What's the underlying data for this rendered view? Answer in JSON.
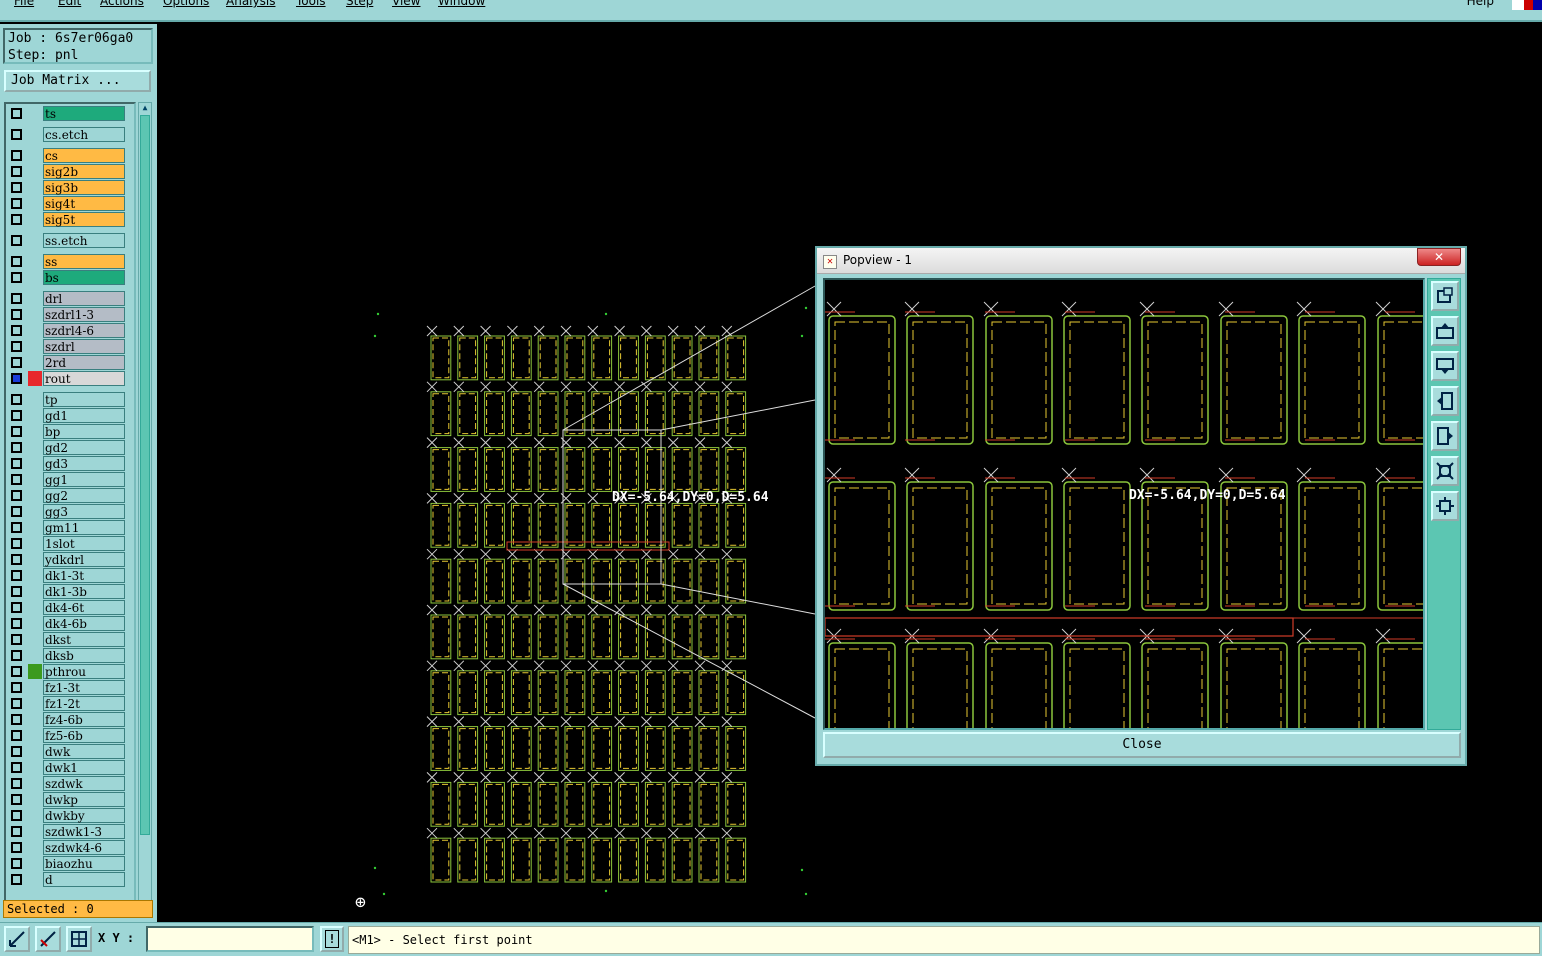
{
  "menubar": {
    "items": [
      "File",
      "Edit",
      "Actions",
      "Options",
      "Analysis",
      "Tools",
      "Step",
      "View",
      "Window"
    ],
    "help": "Help"
  },
  "job": {
    "job_line": "Job : 6s7er06ga0",
    "step_line": "Step: pnl",
    "matrix_button": "Job Matrix ..."
  },
  "layers": [
    {
      "name": "ts",
      "color": "#1eaa7c",
      "gap_before": false
    },
    {
      "name": "cs.etch",
      "color": "#9ed6d6",
      "gap_before": true
    },
    {
      "name": "cs",
      "color": "#ffba44",
      "gap_before": true
    },
    {
      "name": "sig2b",
      "color": "#ffba44",
      "gap_before": false
    },
    {
      "name": "sig3b",
      "color": "#ffba44",
      "gap_before": false
    },
    {
      "name": "sig4t",
      "color": "#ffba44",
      "gap_before": false
    },
    {
      "name": "sig5t",
      "color": "#ffba44",
      "gap_before": false
    },
    {
      "name": "ss.etch",
      "color": "#9ed6d6",
      "gap_before": true
    },
    {
      "name": "ss",
      "color": "#ffba44",
      "gap_before": true
    },
    {
      "name": "bs",
      "color": "#1eaa7c",
      "gap_before": false
    },
    {
      "name": "drl",
      "color": "#b4bcc6",
      "gap_before": true
    },
    {
      "name": "szdrl1-3",
      "color": "#b4bcc6",
      "gap_before": false
    },
    {
      "name": "szdrl4-6",
      "color": "#b4bcc6",
      "gap_before": false
    },
    {
      "name": "szdrl",
      "color": "#b4bcc6",
      "gap_before": false
    },
    {
      "name": "2rd",
      "color": "#b4bcc6",
      "gap_before": false
    },
    {
      "name": "rout",
      "color": "#d8d8d8",
      "gap_before": false,
      "active": true
    },
    {
      "name": "tp",
      "color": "#9ed6d6",
      "gap_before": true
    },
    {
      "name": "gd1",
      "color": "#9ed6d6",
      "gap_before": false
    },
    {
      "name": "bp",
      "color": "#9ed6d6",
      "gap_before": false
    },
    {
      "name": "gd2",
      "color": "#9ed6d6",
      "gap_before": false
    },
    {
      "name": "gd3",
      "color": "#9ed6d6",
      "gap_before": false
    },
    {
      "name": "gg1",
      "color": "#9ed6d6",
      "gap_before": false
    },
    {
      "name": "gg2",
      "color": "#9ed6d6",
      "gap_before": false
    },
    {
      "name": "gg3",
      "color": "#9ed6d6",
      "gap_before": false
    },
    {
      "name": "gm11",
      "color": "#9ed6d6",
      "gap_before": false
    },
    {
      "name": "1slot",
      "color": "#9ed6d6",
      "gap_before": false
    },
    {
      "name": "ydkdrl",
      "color": "#9ed6d6",
      "gap_before": false
    },
    {
      "name": "dk1-3t",
      "color": "#9ed6d6",
      "gap_before": false
    },
    {
      "name": "dk1-3b",
      "color": "#9ed6d6",
      "gap_before": false
    },
    {
      "name": "dk4-6t",
      "color": "#9ed6d6",
      "gap_before": false
    },
    {
      "name": "dk4-6b",
      "color": "#9ed6d6",
      "gap_before": false
    },
    {
      "name": "dkst",
      "color": "#9ed6d6",
      "gap_before": false
    },
    {
      "name": "dksb",
      "color": "#9ed6d6",
      "gap_before": false
    },
    {
      "name": "pthrou",
      "color": "#9ed6d6",
      "gap_before": false,
      "swatch": "#3c9a1e"
    },
    {
      "name": "fz1-3t",
      "color": "#9ed6d6",
      "gap_before": false
    },
    {
      "name": "fz1-2t",
      "color": "#9ed6d6",
      "gap_before": false
    },
    {
      "name": "fz4-6b",
      "color": "#9ed6d6",
      "gap_before": false
    },
    {
      "name": "fz5-6b",
      "color": "#9ed6d6",
      "gap_before": false
    },
    {
      "name": "dwk",
      "color": "#9ed6d6",
      "gap_before": false
    },
    {
      "name": "dwk1",
      "color": "#9ed6d6",
      "gap_before": false
    },
    {
      "name": "szdwk",
      "color": "#9ed6d6",
      "gap_before": false
    },
    {
      "name": "dwkp",
      "color": "#9ed6d6",
      "gap_before": false
    },
    {
      "name": "dwkby",
      "color": "#9ed6d6",
      "gap_before": false
    },
    {
      "name": "szdwk1-3",
      "color": "#9ed6d6",
      "gap_before": false
    },
    {
      "name": "szdwk4-6",
      "color": "#9ed6d6",
      "gap_before": false
    },
    {
      "name": "biaozhu",
      "color": "#9ed6d6",
      "gap_before": false
    },
    {
      "name": "d",
      "color": "#9ed6d6",
      "gap_before": false
    }
  ],
  "selected_text": "Selected : 0",
  "canvas": {
    "measure_text": "DX=-5.64,DY=0,D=5.64",
    "grid_cols": 12,
    "grid_rows": 10
  },
  "popview": {
    "title": "Popview - 1",
    "close_label": "Close",
    "measure_text": "DX=-5.64,DY=0,D=5.64",
    "title_close": "✕",
    "tools": [
      "zoom-window-icon",
      "pan-up-icon",
      "pan-down-icon",
      "pan-left-icon",
      "pan-right-icon",
      "zoom-in-icon",
      "zoom-out-icon"
    ]
  },
  "statusbar": {
    "xy_label": "X Y :",
    "xy_value": "",
    "prompt": "<M1> - Select first point",
    "warn": "!"
  },
  "colors": {
    "panel": "#9ed6d6",
    "trace_green": "#8cc63c",
    "trace_yellow": "#e6c832",
    "trace_red": "#d23c28",
    "cross": "#d0d0d0"
  }
}
